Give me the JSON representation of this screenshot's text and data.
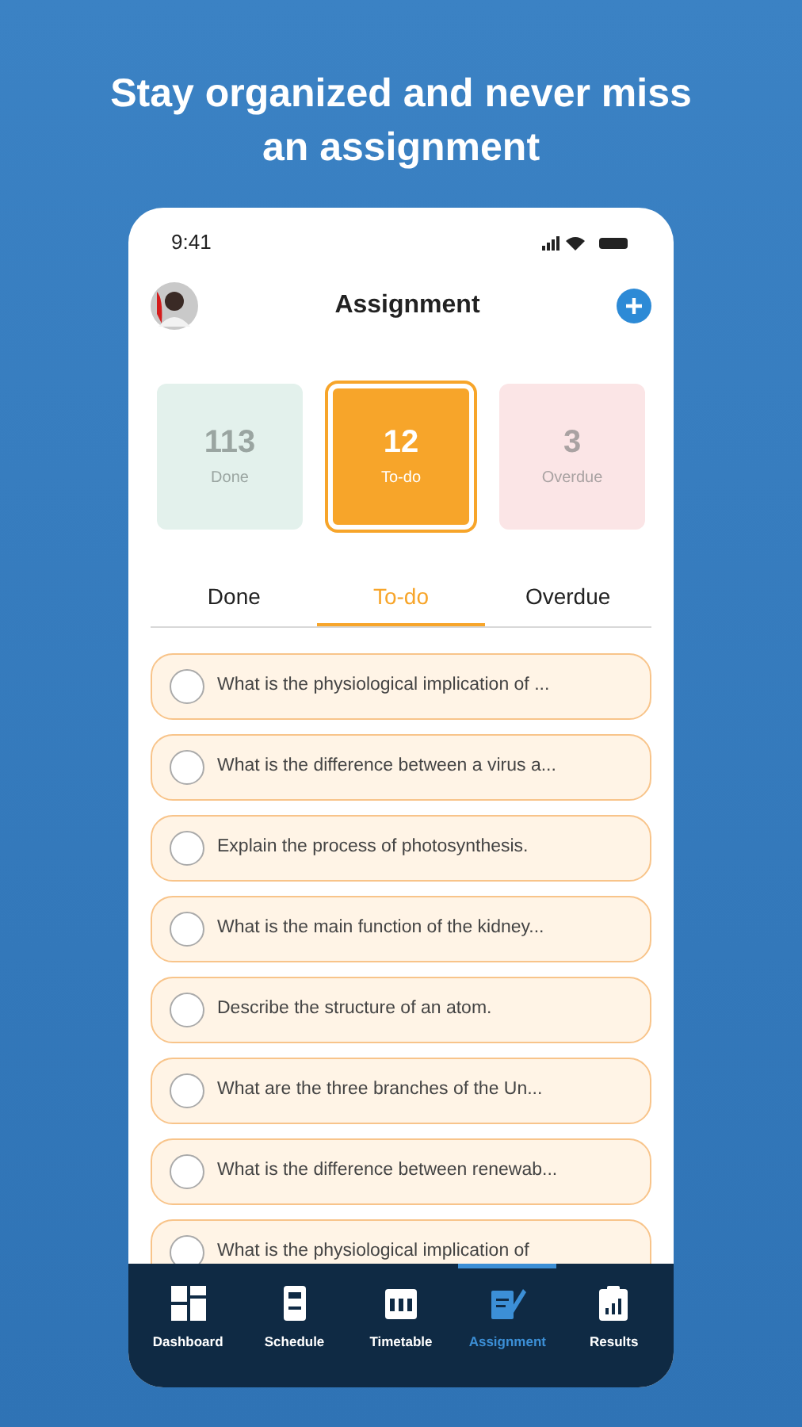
{
  "headline": "Stay organized and never miss an assignment",
  "status_bar": {
    "time": "9:41"
  },
  "header": {
    "title": "Assignment"
  },
  "stats": [
    {
      "value": "113",
      "label": "Done",
      "kind": "done",
      "selected": false
    },
    {
      "value": "12",
      "label": "To-do",
      "kind": "todo",
      "selected": true
    },
    {
      "value": "3",
      "label": "Overdue",
      "kind": "overdue",
      "selected": false
    }
  ],
  "tabs": [
    {
      "label": "Done",
      "selected": false
    },
    {
      "label": "To-do",
      "selected": true
    },
    {
      "label": "Overdue",
      "selected": false
    }
  ],
  "assignments": [
    {
      "text": "What is the physiological implication of ...",
      "checked": false
    },
    {
      "text": "What is the difference between a virus a...",
      "checked": false
    },
    {
      "text": "Explain the process of photosynthesis.",
      "checked": false
    },
    {
      "text": "What is the main function of the kidney...",
      "checked": false
    },
    {
      "text": "Describe the structure of an atom.",
      "checked": false
    },
    {
      "text": "What are the three branches of the Un...",
      "checked": false
    },
    {
      "text": "What is the difference between renewab...",
      "checked": false
    },
    {
      "text": "What is the physiological implication of",
      "checked": false
    }
  ],
  "nav": [
    {
      "label": "Dashboard",
      "kind": "dashboard",
      "selected": false
    },
    {
      "label": "Schedule",
      "kind": "schedule",
      "selected": false
    },
    {
      "label": "Timetable",
      "kind": "timetable",
      "selected": false
    },
    {
      "label": "Assignment",
      "kind": "assignment",
      "selected": true
    },
    {
      "label": "Results",
      "kind": "results",
      "selected": false
    }
  ]
}
